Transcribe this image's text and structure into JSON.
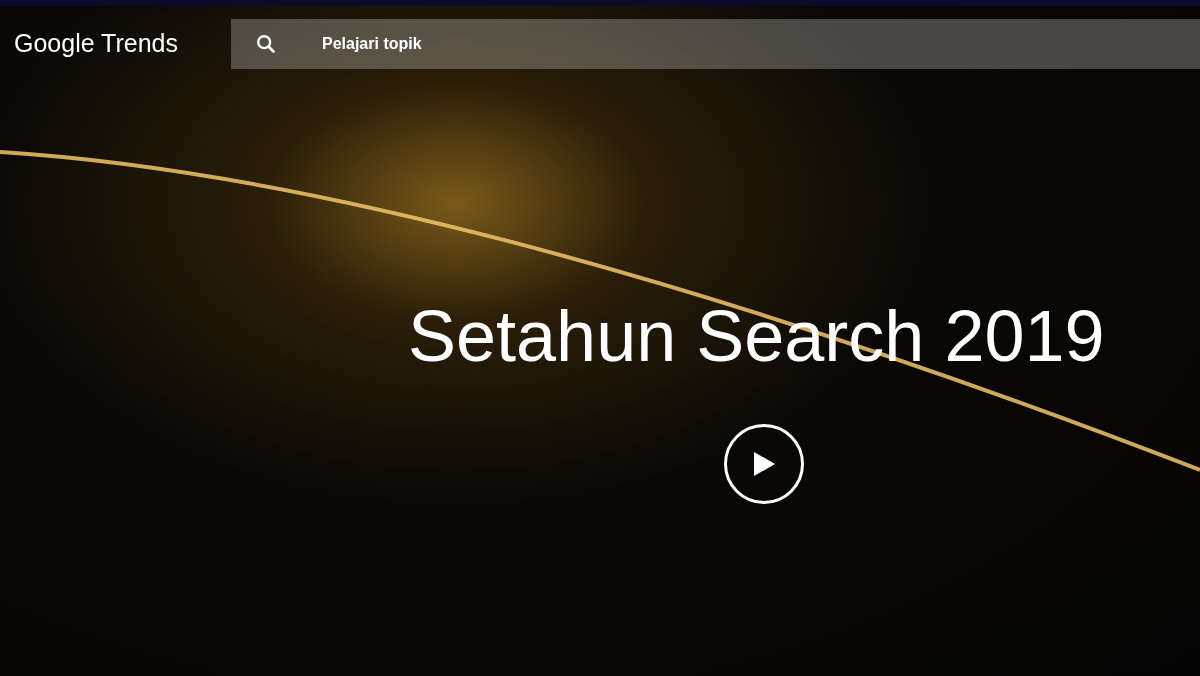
{
  "header": {
    "logo": "Google Trends",
    "search": {
      "placeholder": "Pelajari topik"
    }
  },
  "hero": {
    "title": "Setahun Search 2019"
  }
}
